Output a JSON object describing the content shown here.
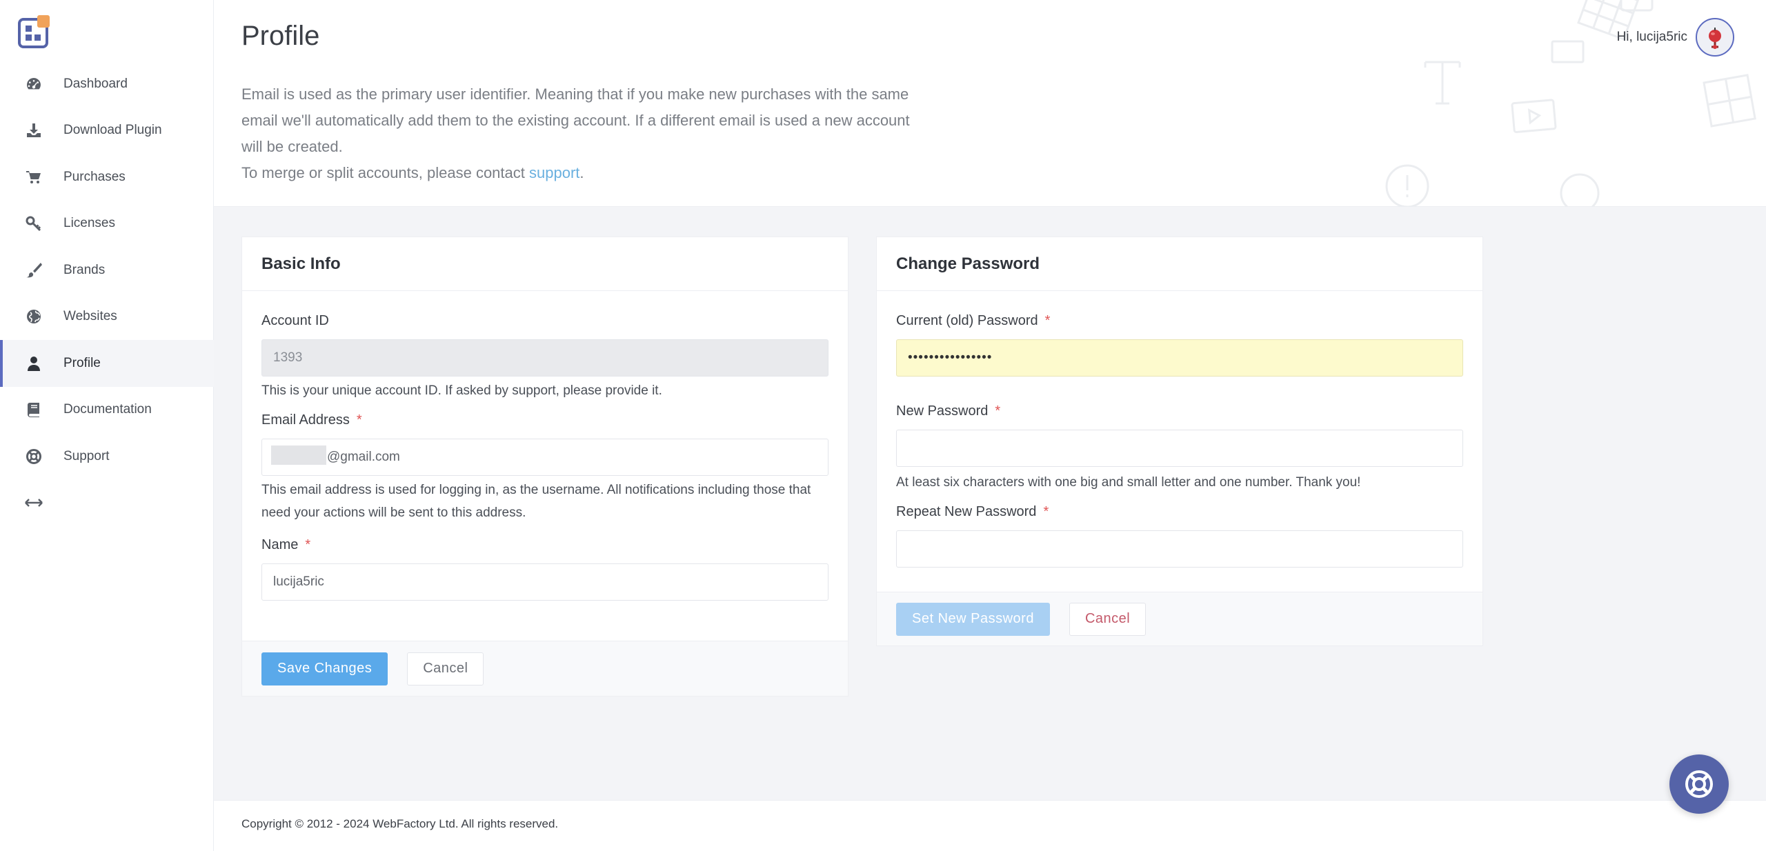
{
  "sidebar": {
    "items": [
      {
        "label": "Dashboard",
        "icon": "dashboard-icon"
      },
      {
        "label": "Download Plugin",
        "icon": "download-icon"
      },
      {
        "label": "Purchases",
        "icon": "cart-icon"
      },
      {
        "label": "Licenses",
        "icon": "key-icon"
      },
      {
        "label": "Brands",
        "icon": "brush-icon"
      },
      {
        "label": "Websites",
        "icon": "globe-icon"
      },
      {
        "label": "Profile",
        "icon": "user-icon",
        "active": true
      },
      {
        "label": "Documentation",
        "icon": "book-icon"
      },
      {
        "label": "Support",
        "icon": "lifebuoy-icon"
      }
    ],
    "expand_icon": "expand-arrows-icon"
  },
  "header": {
    "title": "Profile",
    "intro_text": "Email is used as the primary user identifier. Meaning that if you make new purchases with the same email we'll automatically add them to the existing account. If a different email is used a new account will be created.",
    "merge_text": "To merge or split accounts, please contact ",
    "support_link": "support",
    "merge_end": ".",
    "greeting": "Hi, lucija5ric"
  },
  "basic_info": {
    "title": "Basic Info",
    "account_id_label": "Account ID",
    "account_id_value": "1393",
    "account_id_help": "This is your unique account ID. If asked by support, please provide it.",
    "email_label": "Email Address",
    "email_value": "@gmail.com",
    "email_help": "This email address is used for logging in, as the username. All notifications including those that need your actions will be sent to this address.",
    "name_label": "Name",
    "name_value": "lucija5ric",
    "save_label": "Save Changes",
    "cancel_label": "Cancel"
  },
  "change_password": {
    "title": "Change Password",
    "current_label": "Current (old) Password",
    "current_value": "••••••••••••••••",
    "new_label": "New Password",
    "new_help": "At least six characters with one big and small letter and one number. Thank you!",
    "repeat_label": "Repeat New Password",
    "set_label": "Set New Password",
    "cancel_label": "Cancel"
  },
  "required_mark": "*",
  "footer": {
    "copyright": "Copyright © 2012 - 2024 WebFactory Ltd. All rights reserved."
  },
  "colors": {
    "accent": "#5c6bc0",
    "primary_button": "#5aa9ea",
    "link": "#6ab0df",
    "required": "#e05555",
    "autofill": "#fdfacd"
  }
}
